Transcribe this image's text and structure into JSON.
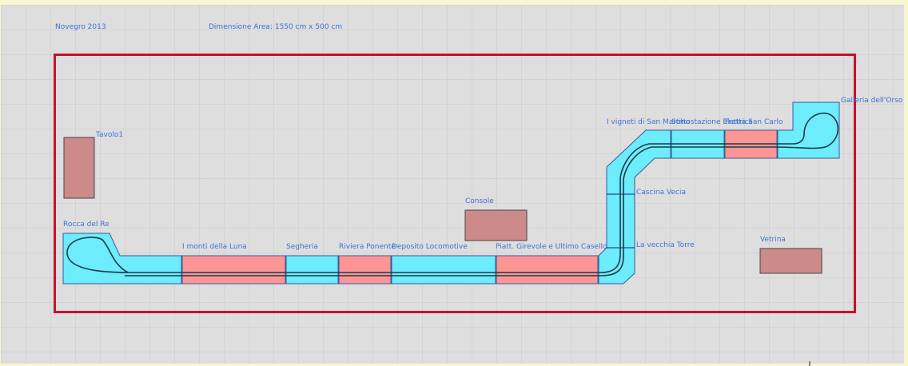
{
  "header": {
    "title": "Novegro 2013",
    "dimension": "Dimensione Area: 1550 cm x 500 cm"
  },
  "modules": [
    {
      "label": "Rocca del Re",
      "color": "#6cecfc"
    },
    {
      "label": "I monti della Luna",
      "color": "#fd9595"
    },
    {
      "label": "Segheria",
      "color": "#6cecfc"
    },
    {
      "label": "Riviera Ponente",
      "color": "#fd9595"
    },
    {
      "label": "Deposito Locomotive",
      "color": "#6cecfc"
    },
    {
      "label": "Piatt. Girevole e Ultimo Casello",
      "color": "#fd9595"
    },
    {
      "label": "La vecchia Torre",
      "color": "#6cecfc"
    },
    {
      "label": "Cascina Vecia",
      "color": "#6cecfc"
    },
    {
      "label": "I vigneti di San Martino",
      "color": "#6cecfc"
    },
    {
      "label": "Sottostazione Elettrica",
      "color": "#6cecfc"
    },
    {
      "label": "Fratta San Carlo",
      "color": "#fd9595"
    },
    {
      "label": "Galleria dell'Orso",
      "color": "#6cecfc"
    }
  ],
  "tables": [
    {
      "label": "Tavolo1"
    },
    {
      "label": "Console"
    },
    {
      "label": "Vetrina"
    }
  ],
  "colors": {
    "background": "#f6f6cf",
    "canvas": "#dedede",
    "grid": "#c9c9c9",
    "border": "#c8102e",
    "label": "#3a72d8",
    "table_fill": "#cc8a8a",
    "track": "#1d3a48"
  }
}
